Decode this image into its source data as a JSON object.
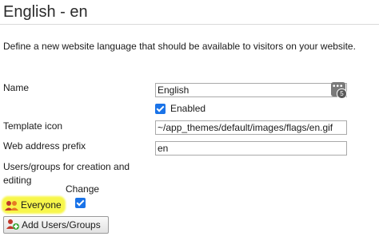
{
  "page": {
    "title": "English - en",
    "description": "Define a new website language that should be available to visitors on your website."
  },
  "form": {
    "name_label": "Name",
    "name_value": "English",
    "language_icon": "localization-icon",
    "language_badge": "5",
    "enabled_label": "Enabled",
    "enabled_checked": true,
    "template_icon_label": "Template icon",
    "template_icon_value": "~/app_themes/default/images/flags/en.gif",
    "web_prefix_label": "Web address prefix",
    "web_prefix_value": "en",
    "users_groups_label": "Users/groups for creation and editing",
    "change_label": "Change",
    "everyone_label": "Everyone",
    "everyone_change_checked": true,
    "add_button_label": "Add Users/Groups"
  },
  "colors": {
    "checkbox": "#1a73e8",
    "highlight": "#f7f64a"
  }
}
